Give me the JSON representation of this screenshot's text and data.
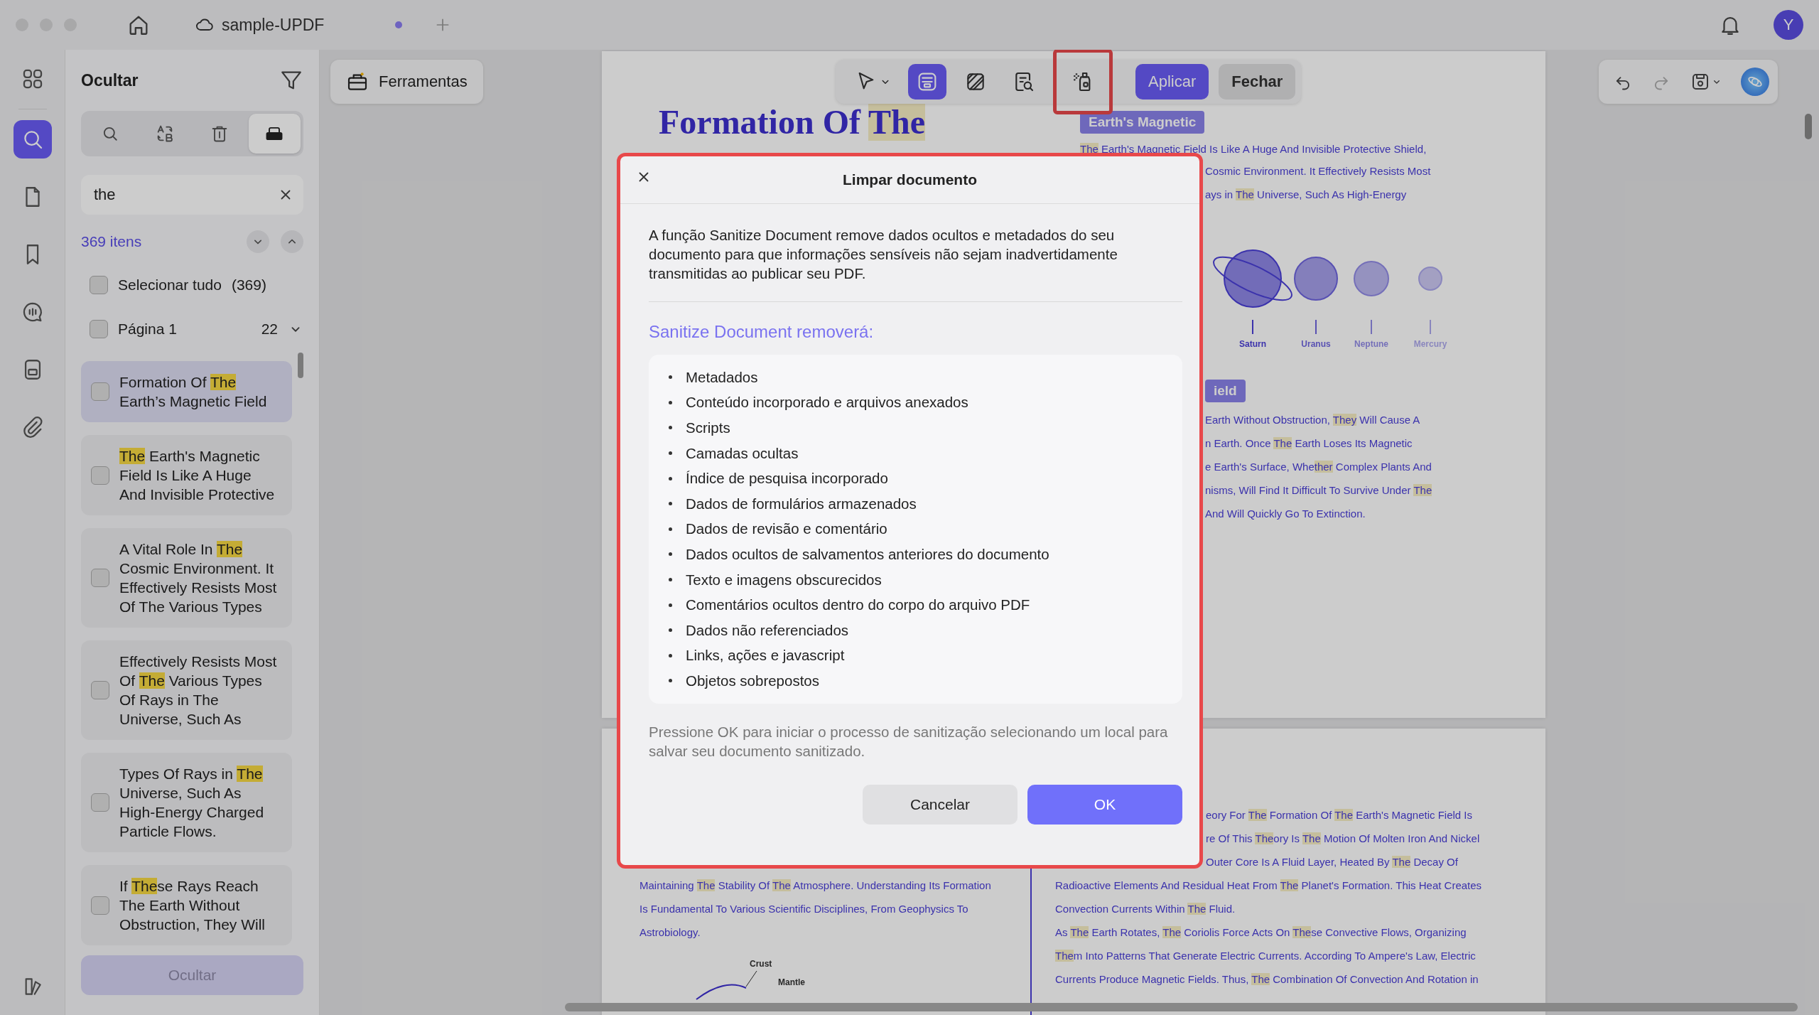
{
  "window": {
    "tab_title": "sample-UPDF",
    "unsaved": true,
    "avatar": "Y"
  },
  "rail": [
    {
      "kind": "apps",
      "selected": false
    },
    {
      "kind": "search",
      "selected": true
    },
    {
      "kind": "pages",
      "selected": false
    },
    {
      "kind": "bookmarks",
      "selected": false
    },
    {
      "kind": "comments",
      "selected": false
    },
    {
      "kind": "forms",
      "selected": false
    },
    {
      "kind": "attachments",
      "selected": false
    }
  ],
  "sidebar": {
    "title": "Ocultar",
    "modes": [
      {
        "kind": "search",
        "selected": false
      },
      {
        "kind": "replace",
        "selected": false
      },
      {
        "kind": "delete",
        "selected": false
      },
      {
        "kind": "redact",
        "selected": true
      }
    ],
    "search": {
      "value": "the"
    },
    "count": "369 itens",
    "select_all": {
      "label": "Selecionar tudo",
      "count": "(369)",
      "checked": false
    },
    "page_group": {
      "label": "Página 1",
      "count": "22",
      "checked": false,
      "expanded": true
    },
    "results": [
      {
        "lines": [
          "Formation Of **The**",
          "Earth’s Magnetic Field"
        ],
        "selected": true,
        "checked": false
      },
      {
        "lines": [
          "**The** Earth's Magnetic",
          "Field Is Like A Huge",
          "And Invisible Protective"
        ],
        "selected": false,
        "checked": false
      },
      {
        "lines": [
          "A Vital Role In **The**",
          "Cosmic Environment. It",
          "Effectively Resists Most",
          "Of The Various Types"
        ],
        "selected": false,
        "checked": false
      },
      {
        "lines": [
          "Effectively Resists Most",
          "Of **The** Various Types",
          "Of Rays in The",
          "Universe, Such As"
        ],
        "selected": false,
        "checked": false
      },
      {
        "lines": [
          "Types Of Rays in **The**",
          "Universe, Such As",
          "High-Energy Charged",
          "Particle Flows."
        ],
        "selected": false,
        "checked": false
      },
      {
        "lines": [
          "If **The**se Rays Reach",
          "The Earth Without",
          "Obstruction, They Will"
        ],
        "selected": false,
        "checked": false
      }
    ],
    "button": {
      "label": "Ocultar",
      "disabled": true
    }
  },
  "toolbar": {
    "tools_label": "Ferramentas",
    "tools": [
      {
        "kind": "pointer",
        "selected": false,
        "highlighted": false
      },
      {
        "kind": "mark-text",
        "selected": true,
        "highlighted": false
      },
      {
        "kind": "mark-area",
        "selected": false,
        "highlighted": false
      },
      {
        "kind": "search-redact",
        "selected": false,
        "highlighted": false
      },
      {
        "kind": "sanitize",
        "selected": false,
        "highlighted": true
      }
    ],
    "apply": "Aplicar",
    "close": "Fechar"
  },
  "document": {
    "page1": {
      "title": "Formation Of **The**",
      "tag": "Earth's Magnetic",
      "lines": [
        {
          "text": "**The** Earth's Magnetic Field Is Like A Huge And Invisible Protective Shield,",
          "kind": "whole"
        },
        {
          "text": "Cosmic Environment. It Effectively Resists Most",
          "kind": "cut"
        },
        {
          "text": "ays in **The** Universe, Such As High-Energy",
          "kind": "cut"
        }
      ],
      "planets": [
        "Saturn",
        "Uranus",
        "Neptune",
        "Mercury"
      ],
      "tag2": "ield",
      "lines2": [
        "Earth Without Obstruction, **They** Will Cause A",
        "n Earth. Once **The** Earth Loses Its Magnetic",
        "e Earth's Surface, Whe**ther** Complex Plants And",
        "nisms, Will Find It Difficult To Survive Under **The**",
        "And Will Quickly Go To Extinction."
      ]
    },
    "page2": {
      "left_lines": [
        "Maintaining **The** Stability Of **The** Atmosphere. Understanding Its Formation",
        "Is Fundamental To Various Scientific Disciplines, From Geophysics To",
        "Astrobiology."
      ],
      "diagram_labels": [
        "Crust",
        "Mantle"
      ],
      "right_lines": [
        {
          "text": "eory For **The** Formation Of **The** Earth's Magnetic Field Is",
          "kind": "cut"
        },
        {
          "text": "re Of This **The**ory Is **The** Motion Of Molten Iron And Nickel",
          "kind": "cut"
        },
        {
          "text": "Outer Core Is A Fluid Layer, Heated By **The** Decay Of",
          "kind": "cut"
        },
        {
          "text": "Radioactive Elements And Residual Heat From **The** Planet's Formation. This Heat Creates",
          "kind": "whole"
        },
        {
          "text": "Convection Currents Within **The** Fluid.",
          "kind": "whole"
        },
        {
          "text": "As **The** Earth Rotates, **The** Coriolis Force Acts On **The**se Convective Flows, Organizing",
          "kind": "whole"
        },
        {
          "text": "**The**m Into Patterns That Generate Electric Currents. According To Ampere's Law, Electric",
          "kind": "whole"
        },
        {
          "text": "Currents Produce Magnetic Fields. Thus, **The** Combination Of Convection And Rotation in",
          "kind": "whole"
        }
      ]
    }
  },
  "dialog": {
    "title": "Limpar documento",
    "highlighted": true,
    "intro": "A função Sanitize Document remove dados ocultos e metadados do seu documento para que informações sensíveis não sejam inadvertidamente transmitidas ao publicar seu PDF.",
    "heading": "Sanitize Document removerá:",
    "items": [
      "Metadados",
      "Conteúdo incorporado e arquivos anexados",
      "Scripts",
      "Camadas ocultas",
      "Índice de pesquisa incorporado",
      "Dados de formulários armazenados",
      "Dados de revisão e comentário",
      "Dados ocultos de salvamentos anteriores do documento",
      "Texto e imagens obscurecidos",
      "Comentários ocultos dentro do corpo do arquivo PDF",
      "Dados não referenciados",
      "Links, ações e javascript",
      "Objetos sobrepostos"
    ],
    "note": "Pressione OK para iniciar o processo de sanitização selecionando um local para salvar seu documento sanitizado.",
    "cancel": "Cancelar",
    "ok": "OK"
  }
}
